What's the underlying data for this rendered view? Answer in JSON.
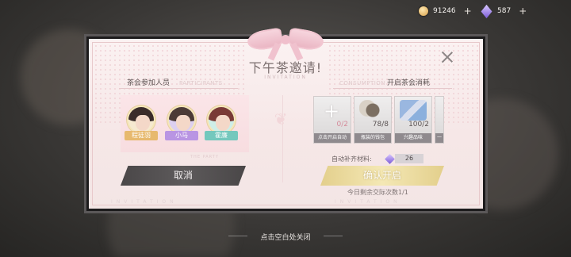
{
  "currency": {
    "gold": "91246",
    "gems": "587",
    "plus": "+"
  },
  "dialog": {
    "title": "下午茶邀请!",
    "title_sub": "INVITATION",
    "participants_label": "茶会参加人员",
    "participants_en": "PARTICIPANTS",
    "consumption_label": "开启茶会消耗",
    "consumption_en": "CONSUMPTION",
    "party_en": "THE PARTY",
    "members": [
      {
        "name": "程徒羽"
      },
      {
        "name": "小马"
      },
      {
        "name": "霍廉"
      }
    ],
    "items": [
      {
        "count": "0/2",
        "label": "点击开启自动"
      },
      {
        "count": "78/8",
        "label": "瓶装的钱包"
      },
      {
        "count": "100/2",
        "label": "兴趣品味"
      },
      {
        "count": "",
        "label": "一"
      }
    ],
    "auto_label": "自动补齐材料:",
    "auto_value": "26",
    "cancel_label": "取消",
    "confirm_label": "确认开启",
    "remaining": "今日剩余交际次数1/1",
    "footer_left": "INVITATION",
    "footer_right": "INVITATION"
  },
  "hint": "点击空白处关闭",
  "colors": {
    "confirm": "#f4e8b5",
    "cancel": "#4a4748",
    "frame": "#1c1b1c"
  }
}
